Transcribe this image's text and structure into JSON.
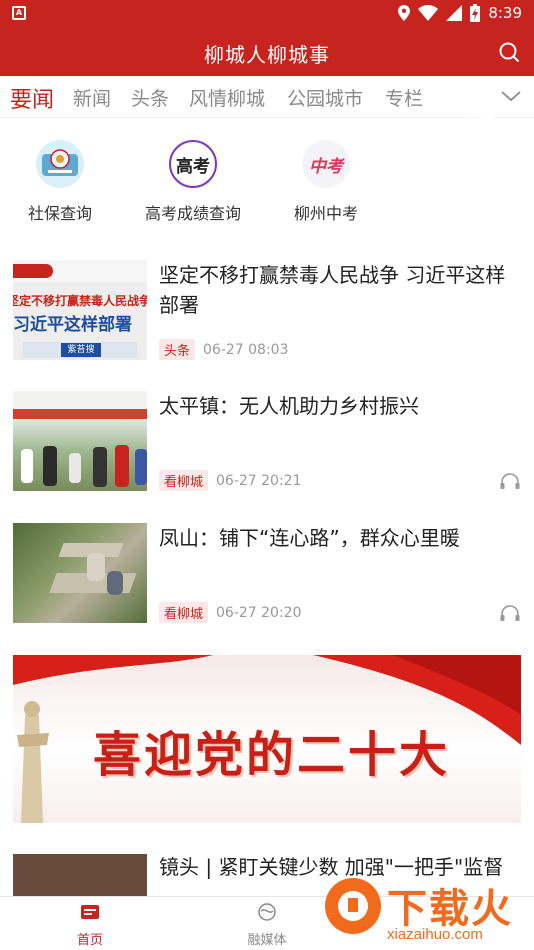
{
  "status_bar": {
    "time": "8:39"
  },
  "header": {
    "title": "柳城人柳城事"
  },
  "tabs": [
    {
      "label": "要闻",
      "active": true
    },
    {
      "label": "新闻"
    },
    {
      "label": "头条"
    },
    {
      "label": "风情柳城"
    },
    {
      "label": "公园城市"
    },
    {
      "label": "专栏"
    }
  ],
  "quick_links": [
    {
      "label": "社保查询",
      "icon": "social-security-icon"
    },
    {
      "label": "高考成绩查询",
      "icon": "gaokao-icon",
      "icon_text": "高考"
    },
    {
      "label": "柳州中考",
      "icon": "zhongkao-icon",
      "icon_text": "中考"
    }
  ],
  "news": [
    {
      "headline": "坚定不移打赢禁毒人民战争  习近平这样部署",
      "tag": "头条",
      "time": "06-27 08:03",
      "thumb_text": [
        "坚定不移打赢禁毒人民战争",
        "习近平这样部署",
        "紫苔搜"
      ]
    },
    {
      "headline": "太平镇：无人机助力乡村振兴",
      "tag": "看柳城",
      "time": "06-27 20:21"
    },
    {
      "headline": "凤山：铺下“连心路”，群众心里暖",
      "tag": "看柳城",
      "time": "06-27 20:20"
    }
  ],
  "banner": {
    "text": "喜迎党的二十大"
  },
  "news_partial": {
    "headline": "镜头 | 紧盯关键少数 加强\"一把手\"监督"
  },
  "bottom_nav": [
    {
      "label": "首页",
      "active": true
    },
    {
      "label": "融媒体"
    }
  ],
  "watermark": {
    "text": "下载火",
    "url": "xiazaihuo.com"
  },
  "colors": {
    "brand_red": "#c8241f",
    "watermark_orange": "#f26b1d"
  }
}
